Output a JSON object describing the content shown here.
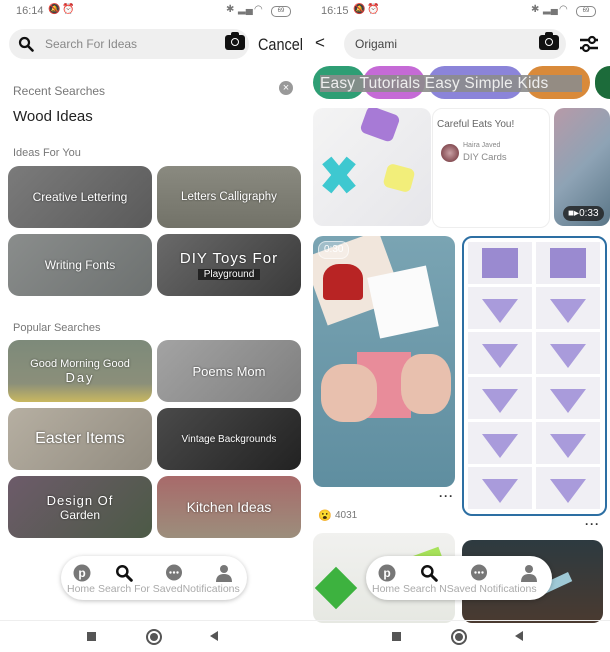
{
  "left": {
    "status": {
      "time": "16:14",
      "battery": "69"
    },
    "search": {
      "placeholder": "Search For Ideas",
      "cancel_label": "Cancel"
    },
    "recent": {
      "label": "Recent Searches",
      "items": [
        "Wood Ideas"
      ]
    },
    "ideas": {
      "label": "Ideas For You",
      "tiles": [
        {
          "label": "Creative Lettering"
        },
        {
          "label": "Letters Calligraphy"
        },
        {
          "label": "Writing Fonts"
        },
        {
          "label": "DIY Toys For",
          "sub": "Playground"
        }
      ]
    },
    "popular": {
      "label": "Popular Searches",
      "tiles": [
        {
          "label": "Good Morning Good",
          "sub": "Day"
        },
        {
          "label": "Poems Mom"
        },
        {
          "label": "Easter Items"
        },
        {
          "label": "Vintage Backgrounds"
        },
        {
          "label": "Design Of",
          "sub": "Garden"
        },
        {
          "label": "Kitchen Ideas"
        }
      ]
    },
    "nav": {
      "home": "Home",
      "search": "Search For",
      "saved": "Saved",
      "notifications": "Notifications"
    }
  },
  "right": {
    "status": {
      "time": "16:15",
      "battery": "69"
    },
    "search": {
      "value": "Origami"
    },
    "chips": {
      "text": "Easy Tutorials Easy Simple Kids",
      "colors": [
        "#2e9e74",
        "#c56ad6",
        "#8b84d9",
        "#d98a3a",
        "#1c6b3a"
      ]
    },
    "pins": {
      "card_title": "Careful Eats You!",
      "card_user": "Haira Javed",
      "card_board": "DIY Cards",
      "video1_duration": "0:33",
      "video2_duration": "0:30",
      "reaction_count": "4031"
    },
    "nav": {
      "home": "Home",
      "search": "Search N",
      "saved": "Saved",
      "notifications": "Notifications"
    }
  }
}
